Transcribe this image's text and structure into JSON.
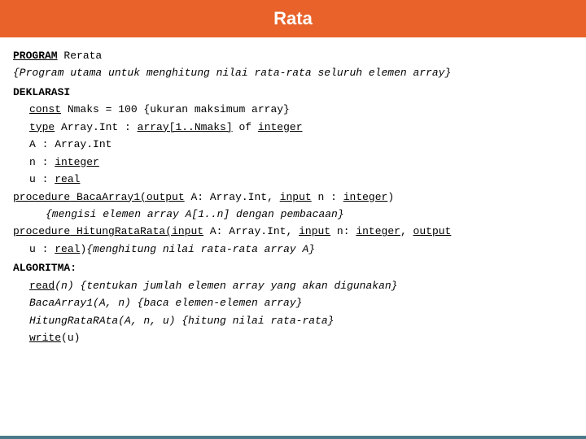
{
  "header": {
    "title": "Rata"
  },
  "code": {
    "program_keyword": "PROGRAM",
    "program_name": " Rerata",
    "comment1": "{Program utama untuk menghitung nilai rata-rata seluruh elemen array}",
    "deklarasi": "DEKLARASI",
    "const_keyword": "const",
    "const_rest": " Nmaks = 100 {ukuran maksimum array}",
    "type_keyword": "type",
    "type_rest1": " Array.Int : ",
    "type_array": "array[1..Nmaks]",
    "type_rest2": " of ",
    "type_integer": "integer",
    "a_line": "A : Array.Int",
    "n_line": "n : ",
    "n_integer": "integer",
    "u_line": "u : ",
    "u_real": "real",
    "proc1_keyword": "procedure",
    "proc1_name": " BacaArray1(",
    "proc1_output": "output",
    "proc1_rest1": " A: Array.Int, ",
    "proc1_input": "input",
    "proc1_rest2": " n : ",
    "proc1_integer": "integer",
    "proc1_end": ")",
    "proc1_comment": "{mengisi elemen array A[1..n] dengan pembacaan}",
    "proc2_keyword": "procedure",
    "proc2_name": " HitungRataRata(",
    "proc2_input": "input",
    "proc2_rest1": " A: Array.Int, ",
    "proc2_input2": "input",
    "proc2_rest2": " n: ",
    "proc2_integer": "integer",
    "proc2_comma": ", ",
    "proc2_output": "output",
    "proc2_newline": "u : ",
    "proc2_real": "real",
    "proc2_comment": "{menghitung nilai rata-rata array A}",
    "algoritma": "ALGORITMA:",
    "read_keyword": "read",
    "read_rest": "(n) {tentukan jumlah elemen array yang akan digunakan}",
    "baca_line": "BacaArray1(A, n) {baca elemen-elemen array}",
    "hitung_line": "HitungRataRAta(A, n, u) {hitung nilai rata-rata}",
    "write_keyword": "write",
    "write_rest": "(u)"
  }
}
